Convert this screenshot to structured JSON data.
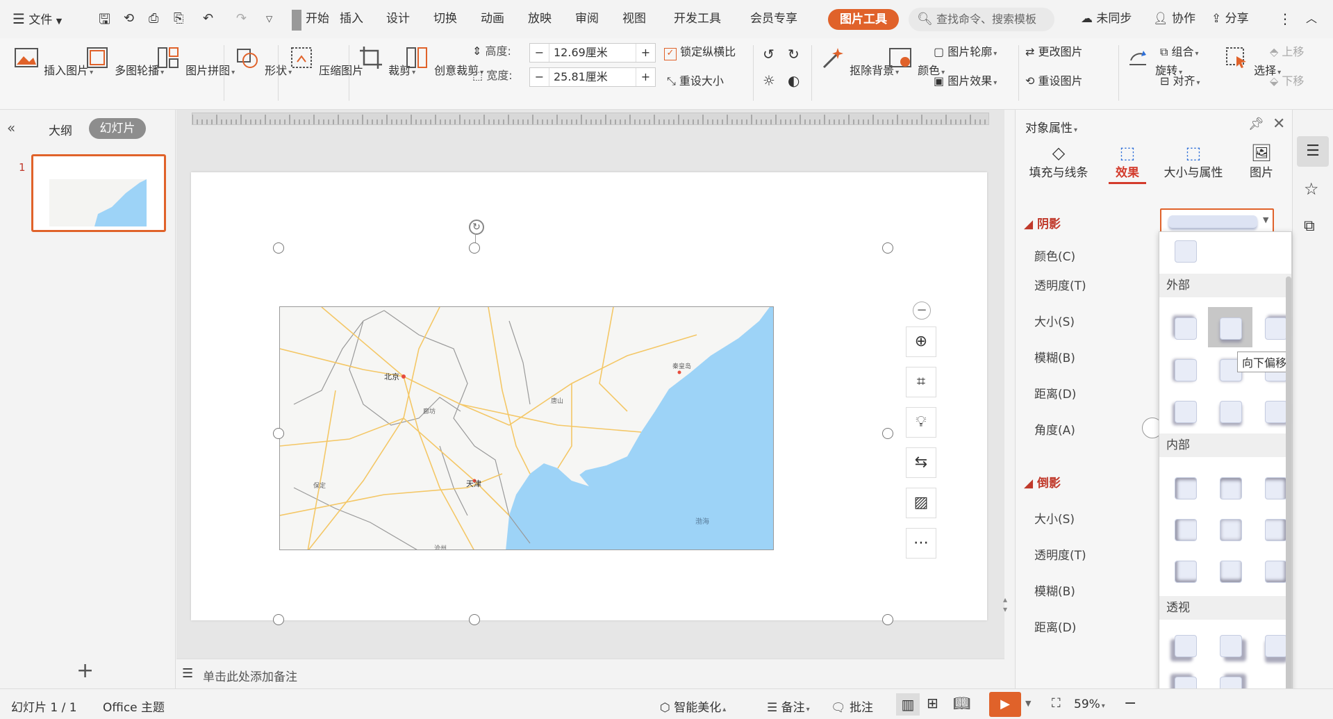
{
  "menu": {
    "file": "文件",
    "tabs": [
      "开始",
      "插入",
      "设计",
      "切换",
      "动画",
      "放映",
      "审阅",
      "视图",
      "开发工具",
      "会员专享"
    ],
    "active_tab": "图片工具",
    "search_placeholder": "查找命令、搜索模板",
    "sync": "未同步",
    "collab": "协作",
    "share": "分享"
  },
  "ribbon": {
    "insert_picture": "插入图片",
    "multi_carousel": "多图轮播",
    "picture_collage": "图片拼图",
    "shape": "形状",
    "compress": "压缩图片",
    "crop": "裁剪",
    "creative_crop": "创意裁剪",
    "height_label": "高度:",
    "height_value": "12.69厘米",
    "width_label": "宽度:",
    "width_value": "25.81厘米",
    "lock_ratio": "锁定纵横比",
    "reset_size": "重设大小",
    "remove_bg": "抠除背景",
    "color": "颜色",
    "outline": "图片轮廓",
    "effect": "图片效果",
    "change_pic": "更改图片",
    "reset_pic": "重设图片",
    "rotate": "旋转",
    "group": "组合",
    "align": "对齐",
    "select": "选择",
    "move_up": "上移",
    "move_down": "下移"
  },
  "left_panel": {
    "tab_outline": "大纲",
    "tab_slides": "幻灯片",
    "slide_number": "1"
  },
  "map": {
    "beijing": "北京",
    "tianjin": "天津",
    "langfang": "廊坊",
    "tangshan": "唐山",
    "baoding": "保定",
    "qinhuangdao": "秦皇岛",
    "bohai": "渤海",
    "cangzhou": "沧州"
  },
  "notes_placeholder": "单击此处添加备注",
  "right_panel": {
    "title": "对象属性",
    "tabs": [
      "填充与线条",
      "效果",
      "大小与属性",
      "图片"
    ],
    "active_tab": "效果",
    "shadow_section": "阴影",
    "shadow_fields": [
      "颜色(C)",
      "透明度(T)",
      "大小(S)",
      "模糊(B)",
      "距离(D)",
      "角度(A)"
    ],
    "reflection_section": "倒影",
    "reflection_fields": [
      "大小(S)",
      "透明度(T)",
      "模糊(B)",
      "距离(D)"
    ]
  },
  "popup": {
    "outer": "外部",
    "inner": "内部",
    "perspective": "透视",
    "tooltip": "向下偏移"
  },
  "status": {
    "slide_info": "幻灯片 1 / 1",
    "theme": "Office 主题",
    "smart_beautify": "智能美化",
    "notes": "备注",
    "comments": "批注",
    "zoom": "59%"
  },
  "colors": {
    "accent": "#e0622a",
    "active_red": "#d33b2c",
    "sea": "#9dd3f7",
    "land": "#f6f6f4"
  }
}
